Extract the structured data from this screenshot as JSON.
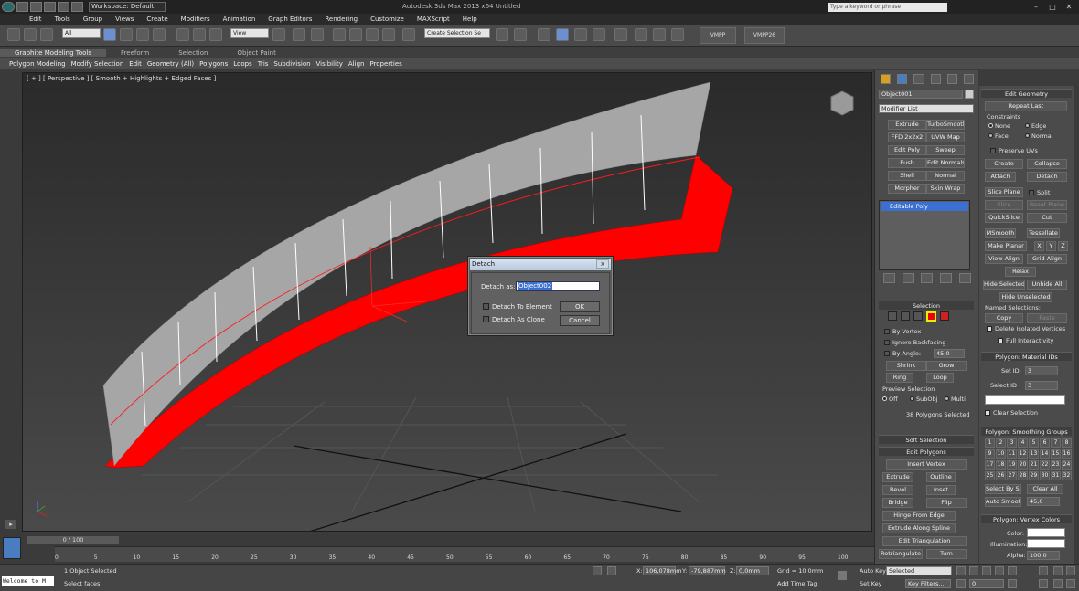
{
  "titlebar": {
    "workspace": "Workspace: Default",
    "title": "Autodesk 3ds Max  2013 x64    Untitled",
    "search_placeholder": "Type a keyword or phrase"
  },
  "menu": [
    "Edit",
    "Tools",
    "Group",
    "Views",
    "Create",
    "Modifiers",
    "Animation",
    "Graph Editors",
    "Rendering",
    "Customize",
    "MAXScript",
    "Help"
  ],
  "toolbar": {
    "filter": "All",
    "refcoord": "View",
    "selset": "Create Selection Se",
    "vmpp": "VMPP",
    "vmpp26": "VMPP26"
  },
  "ribbon_tabs": [
    "Graphite Modeling Tools",
    "Freeform",
    "Selection",
    "Object Paint"
  ],
  "ribbon_panels": [
    "Polygon Modeling",
    "Modify Selection",
    "Edit",
    "Geometry (All)",
    "Polygons",
    "Loops",
    "Tris",
    "Subdivision",
    "Visibility",
    "Align",
    "Properties"
  ],
  "viewport": {
    "label": "[ + ] [ Perspective ] [ Smooth + Highlights + Edged Faces ]"
  },
  "dialog": {
    "title": "Detach",
    "close": "x",
    "detach_as_label": "Detach as:",
    "name": "Object002",
    "to_element": "Detach To Element",
    "as_clone": "Detach As Clone",
    "ok": "OK",
    "cancel": "Cancel"
  },
  "command_panel": {
    "object_name": "Object001",
    "modifier_list": "Modifier List",
    "modifier_buttons": [
      "Extrude",
      "TurboSmooth",
      "FFD 2x2x2",
      "UVW Map",
      "Edit Poly",
      "Sweep",
      "Push",
      "Edit Normals",
      "Shell",
      "Normal",
      "Morpher",
      "Skin Wrap"
    ],
    "stack_item": "Editable Poly",
    "selection": {
      "title": "Selection",
      "by_vertex": "By Vertex",
      "ignore_backfacing": "Ignore Backfacing",
      "by_angle": "By Angle:",
      "angle": "45,0",
      "shrink": "Shrink",
      "grow": "Grow",
      "ring": "Ring",
      "loop": "Loop",
      "preview": "Preview Selection",
      "off": "Off",
      "subobj": "SubObj",
      "multi": "Multi",
      "status": "38 Polygons Selected"
    },
    "soft_selection": "Soft Selection",
    "edit_polygons": {
      "title": "Edit Polygons",
      "insert_vertex": "Insert Vertex",
      "extrude": "Extrude",
      "outline": "Outline",
      "bevel": "Bevel",
      "inset": "Inset",
      "bridge": "Bridge",
      "flip": "Flip",
      "hinge": "Hinge From Edge",
      "extrude_spline": "Extrude Along Spline",
      "edit_tri": "Edit Triangulation",
      "retriangulate": "Retriangulate",
      "turn": "Turn"
    }
  },
  "edit_geometry": {
    "title": "Edit Geometry",
    "repeat_last": "Repeat Last",
    "constraints": "Constraints",
    "none": "None",
    "edge": "Edge",
    "face": "Face",
    "normal": "Normal",
    "preserve_uvs": "Preserve UVs",
    "create": "Create",
    "collapse": "Collapse",
    "attach": "Attach",
    "detach": "Detach",
    "slice_plane": "Slice Plane",
    "split": "Split",
    "slice": "Slice",
    "reset_plane": "Reset Plane",
    "quickslice": "QuickSlice",
    "cut": "Cut",
    "msmooth": "MSmooth",
    "tessellate": "Tessellate",
    "make_planar": "Make Planar",
    "x": "X",
    "y": "Y",
    "z": "Z",
    "view_align": "View Align",
    "grid_align": "Grid Align",
    "relax": "Relax",
    "hide_selected": "Hide Selected",
    "unhide_all": "Unhide All",
    "hide_unselected": "Hide Unselected",
    "named_selections": "Named Selections:",
    "copy": "Copy",
    "paste": "Paste",
    "delete_isolated": "Delete Isolated Vertices",
    "full_interactivity": "Full Interactivity"
  },
  "material_ids": {
    "title": "Polygon: Material IDs",
    "set_id_label": "Set ID:",
    "set_id": "3",
    "select_id_label": "Select ID",
    "select_id": "3",
    "clear_selection": "Clear Selection"
  },
  "smoothing": {
    "title": "Polygon: Smoothing Groups",
    "groups": [
      "1",
      "2",
      "3",
      "4",
      "5",
      "6",
      "7",
      "8",
      "9",
      "10",
      "11",
      "12",
      "13",
      "14",
      "15",
      "16",
      "17",
      "18",
      "19",
      "20",
      "21",
      "22",
      "23",
      "24",
      "25",
      "26",
      "27",
      "28",
      "29",
      "30",
      "31",
      "32"
    ],
    "select_by_sg": "Select By SG",
    "clear_all": "Clear All",
    "auto_smooth": "Auto Smooth",
    "threshold": "45,0"
  },
  "vertex_colors": {
    "title": "Polygon: Vertex Colors",
    "color": "Color:",
    "illumination": "Illumination:",
    "alpha": "Alpha:",
    "alpha_val": "100,0"
  },
  "timeline": {
    "frame": "0 / 100",
    "ticks": [
      "0",
      "5",
      "10",
      "15",
      "20",
      "25",
      "30",
      "35",
      "40",
      "45",
      "50",
      "55",
      "60",
      "65",
      "70",
      "75",
      "80",
      "85",
      "90",
      "95",
      "100"
    ]
  },
  "status": {
    "welcome": "Welcome to M",
    "selected": "1 Object Selected",
    "prompt": "Select faces",
    "x": "106,078mm",
    "y": "-79,887mm",
    "z": "0,0mm",
    "grid": "Grid = 10,0mm",
    "add_time_tag": "Add Time Tag",
    "auto_key": "Auto Key",
    "set_key": "Set Key",
    "key_mode": "Selected",
    "key_filters": "Key Filters...",
    "frame": "0"
  },
  "colors": {
    "selected_faces": "#ff0000",
    "mesh": "#a6a6a6",
    "dialog_title": "#c9d6e8"
  }
}
